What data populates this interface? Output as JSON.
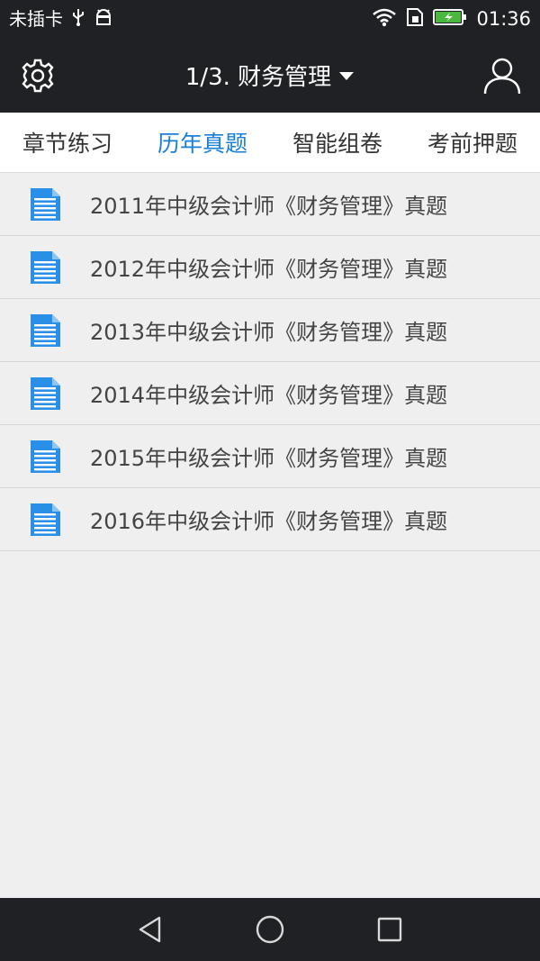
{
  "status_bar": {
    "carrier": "未插卡",
    "time": "01:36"
  },
  "toolbar": {
    "title": "1/3. 财务管理"
  },
  "tabs": [
    {
      "label": "章节练习",
      "active": false
    },
    {
      "label": "历年真题",
      "active": true
    },
    {
      "label": "智能组卷",
      "active": false
    },
    {
      "label": "考前押题",
      "active": false
    }
  ],
  "list": {
    "items": [
      {
        "label": "2011年中级会计师《财务管理》真题"
      },
      {
        "label": "2012年中级会计师《财务管理》真题"
      },
      {
        "label": "2013年中级会计师《财务管理》真题"
      },
      {
        "label": "2014年中级会计师《财务管理》真题"
      },
      {
        "label": "2015年中级会计师《财务管理》真题"
      },
      {
        "label": "2016年中级会计师《财务管理》真题"
      }
    ]
  },
  "colors": {
    "accent": "#1a7fd9",
    "doc_icon": "#2a8fe6",
    "bar_background": "#1f2125",
    "page_background": "#efefef",
    "battery_green": "#49b83c"
  },
  "icons": {
    "status": [
      "usb-icon",
      "android-debug-icon",
      "wifi-icon",
      "sim-card-icon",
      "battery-charging-icon"
    ],
    "toolbar": [
      "gear-icon",
      "caret-down-icon",
      "user-icon"
    ],
    "list_item": "document-icon",
    "navigation": [
      "back-triangle-icon",
      "home-circle-icon",
      "recents-square-icon"
    ]
  }
}
